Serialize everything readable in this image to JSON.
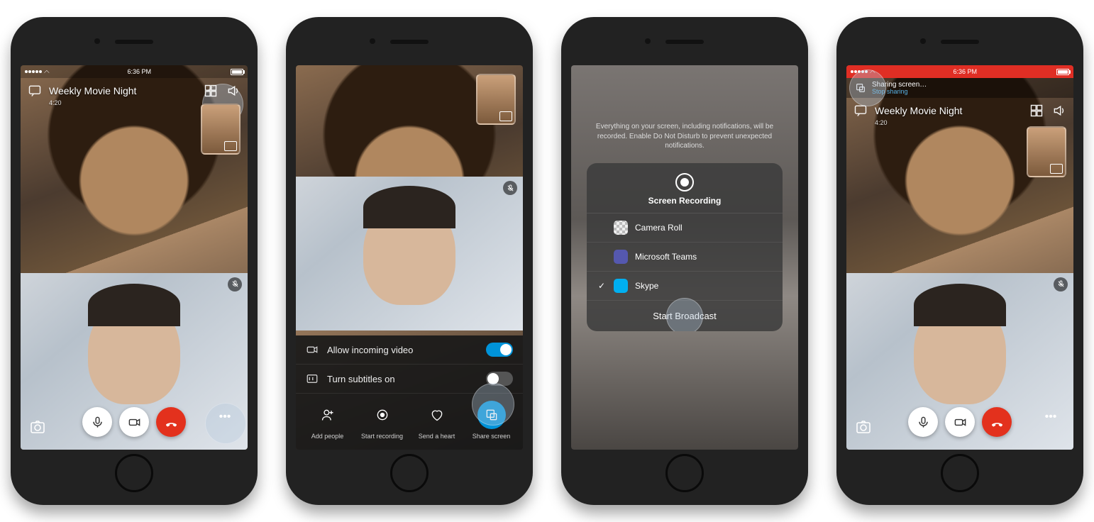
{
  "status": {
    "time": "6:36 PM"
  },
  "call": {
    "title": "Weekly Movie Night",
    "duration": "4:20"
  },
  "sheet": {
    "allow_incoming": "Allow incoming video",
    "subtitles": "Turn subtitles on",
    "actions": {
      "add_people": "Add people",
      "start_recording": "Start recording",
      "send_heart": "Send a heart",
      "share_screen": "Share screen"
    }
  },
  "ios": {
    "hint": "Everything on your screen, including notifications, will be recorded. Enable Do Not Disturb to prevent unexpected notifications.",
    "title": "Screen Recording",
    "apps": {
      "camera_roll": "Camera Roll",
      "teams": "Microsoft Teams",
      "skype": "Skype"
    },
    "start": "Start Broadcast"
  },
  "sharing": {
    "title": "Sharing screen…",
    "stop": "Stop sharing"
  },
  "colors": {
    "accent": "#0093d9",
    "hangup": "#e3311d",
    "teams": "#5558af",
    "skype": "#00aff0",
    "recording_bar": "#e02e24"
  }
}
